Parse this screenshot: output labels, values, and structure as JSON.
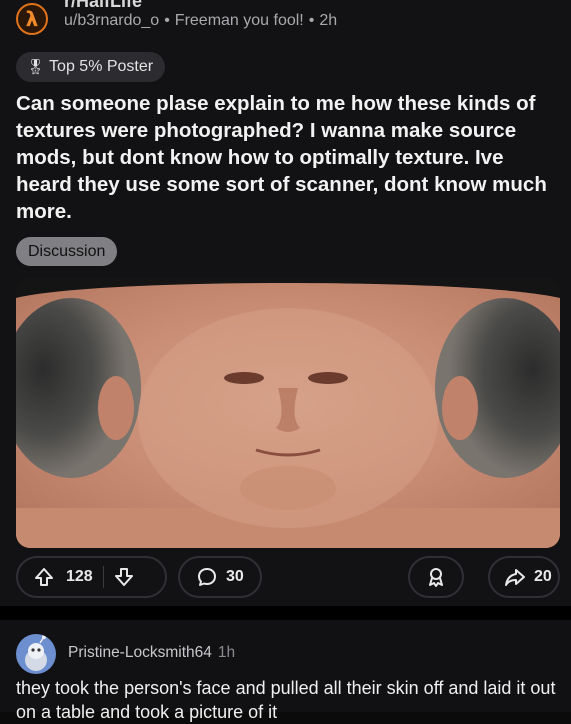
{
  "post": {
    "subreddit": "r/HalfLife",
    "author": "u/b3rnardo_o",
    "author_flair": "Freeman you fool!",
    "age": "2h",
    "badge": "Top 5% Poster",
    "title": "Can someone plase explain to me how these kinds of textures were photographed? I wanna make source mods, but dont know how to optimally texture. Ive heard they use some sort of scanner, dont know much more.",
    "tag": "Discussion",
    "upvotes": "128",
    "comments": "30",
    "shares": "20"
  },
  "comment": {
    "author": "Pristine-Locksmith64",
    "age": "1h",
    "text": "they took the person's face and pulled all their skin off and laid it out on a table and took a picture of it"
  },
  "icons": {
    "subreddit": "lambda-icon",
    "badge": "medal-icon",
    "upvote": "arrow-up-icon",
    "downvote": "arrow-down-icon",
    "comment": "speech-bubble-icon",
    "award": "award-icon",
    "share": "share-arrow-icon"
  },
  "colors": {
    "background": "#121214",
    "accent_orange": "#e0731b",
    "tag_bg": "#7f7f84"
  }
}
